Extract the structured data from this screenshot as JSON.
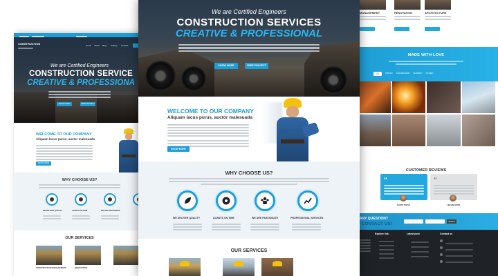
{
  "hero": {
    "tagline": "We are Certified Engineers",
    "title_line1": "CONSTRUCTION SERVICES",
    "title_line2": "CREATIVE & PROFESSIONAL",
    "btn_more": "KNOW MORE",
    "btn_free": "FREE PROJECT"
  },
  "left_hero": {
    "tagline": "We are Certified Engineers",
    "title_line1": "CONSTRUCTION SERVICE",
    "title_line2": "CREATIVE & PROFESSIONA",
    "brand": "CONSTRUCTION",
    "nav": [
      "Home",
      "About",
      "Blog",
      "Gallery",
      "Contact"
    ]
  },
  "welcome": {
    "title": "WELCOME TO OUR COMPANY",
    "subtitle": "Aliquam lacus purus, auctor malesuada",
    "btn": "KNOW MORE"
  },
  "why": {
    "title": "WHY CHOOSE US?",
    "features": [
      "WE DELIVER QUALITY",
      "ALWAYS ON TIME",
      "WE ARE PASSIONATE",
      "PROFESSIONAL SERVICES"
    ]
  },
  "services": {
    "title": "OUR SERVICES",
    "items": [
      "CONSTRUCTION MANAGEMENT",
      "RENOVATION",
      "ARCHITECTURE"
    ]
  },
  "right": {
    "top_items": [
      "MANAGEMENT",
      "RENOVATION",
      "ARCHITECTURE"
    ],
    "made_title": "MADE WITH LOVE",
    "tabs": [
      "All",
      "Interior",
      "Construction",
      "Isolation",
      "Design"
    ],
    "reviews_title": "CUSTOMER REVIEWS",
    "reviewers": [
      "CHRIS PHAN",
      "LEEAN HOPE"
    ],
    "quote_t1": "VE ANY QUESTION?",
    "quote_t2": "TO CONTACT US!",
    "submit": "Submit",
    "footer_heads": [
      "Explore link",
      "Latest post",
      "Contact us"
    ]
  },
  "colors": {
    "accent": "#1e9ed6",
    "accent_light": "#29b6f2",
    "dark_footer": "#1f2328"
  }
}
